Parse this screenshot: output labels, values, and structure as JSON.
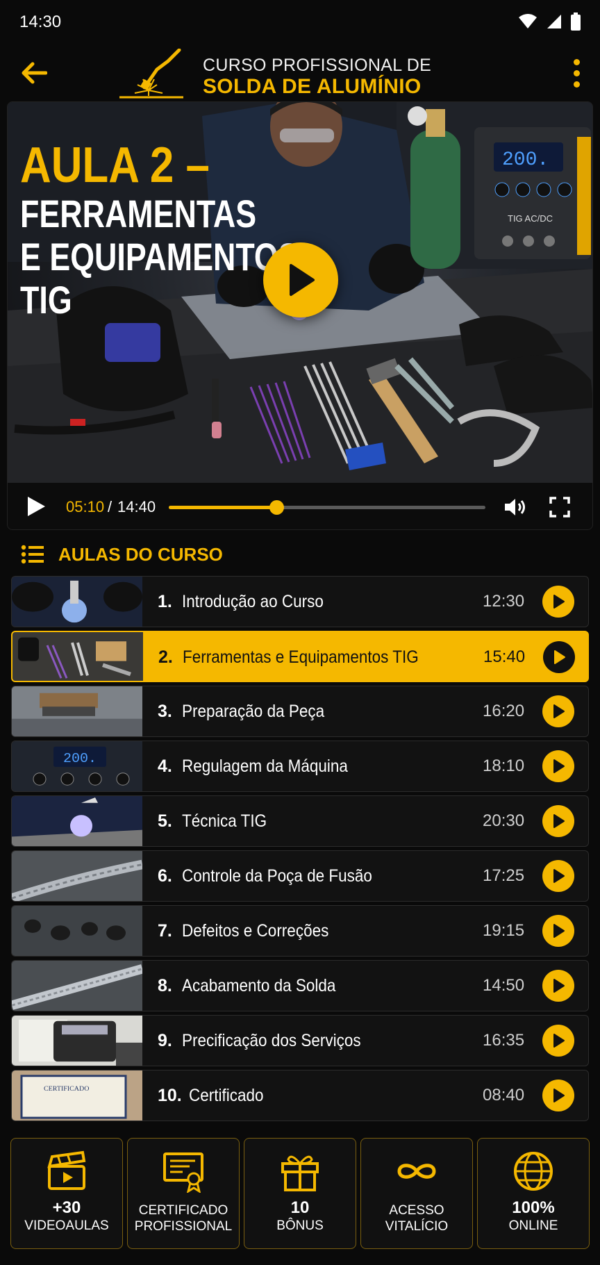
{
  "status_bar": {
    "time": "14:30",
    "icons": [
      "wifi-icon",
      "signal-icon",
      "battery-icon"
    ]
  },
  "header": {
    "title_line1": "CURSO PROFISSIONAL DE",
    "title_line2": "SOLDA DE ALUMÍNIO",
    "back_icon": "arrow-left-icon",
    "menu_icon": "more-vertical-icon"
  },
  "video": {
    "title_line1": "AULA 2 –",
    "title_line2": "FERRAMENTAS",
    "title_line3": "E EQUIPAMENTOS",
    "title_line4": "TIG",
    "machine_display": "200.",
    "machine_label": "TIG AC/DC",
    "current_time": "05:10",
    "separator": "/",
    "total_time": "14:40",
    "progress": 0.339
  },
  "section": {
    "title": "AULAS DO CURSO"
  },
  "lessons": [
    {
      "num": "1.",
      "title": "Introdução ao Curso",
      "duration": "12:30",
      "active": false
    },
    {
      "num": "2.",
      "title": "Ferramentas e Equipamentos TIG",
      "duration": "15:40",
      "active": true
    },
    {
      "num": "3.",
      "title": "Preparação da Peça",
      "duration": "16:20",
      "active": false
    },
    {
      "num": "4.",
      "title": "Regulagem da Máquina",
      "duration": "18:10",
      "active": false
    },
    {
      "num": "5.",
      "title": "Técnica TIG",
      "duration": "20:30",
      "active": false
    },
    {
      "num": "6.",
      "title": "Controle da Poça de Fusão",
      "duration": "17:25",
      "active": false
    },
    {
      "num": "7.",
      "title": "Defeitos e Correções",
      "duration": "19:15",
      "active": false
    },
    {
      "num": "8.",
      "title": "Acabamento da Solda",
      "duration": "14:50",
      "active": false
    },
    {
      "num": "9.",
      "title": "Precificação dos Serviços",
      "duration": "16:35",
      "active": false
    },
    {
      "num": "10.",
      "title": "Certificado",
      "duration": "08:40",
      "active": false
    }
  ],
  "lesson_thumb_texts": {
    "machine": "200.",
    "certificate": "CERTIFICADO"
  },
  "features": [
    {
      "icon": "clapperboard-icon",
      "big": "+30",
      "small1": "VIDEOAULAS",
      "small2": ""
    },
    {
      "icon": "certificate-icon",
      "big": "",
      "small1": "CERTIFICADO",
      "small2": "PROFISSIONAL"
    },
    {
      "icon": "gift-icon",
      "big": "10",
      "small1": "BÔNUS",
      "small2": ""
    },
    {
      "icon": "infinity-icon",
      "big": "",
      "small1": "ACESSO",
      "small2": "VITALÍCIO"
    },
    {
      "icon": "globe-icon",
      "big": "100%",
      "small1": "ONLINE",
      "small2": ""
    }
  ],
  "colors": {
    "accent": "#f5b800",
    "background": "#0a0a0a",
    "row": "#121212"
  }
}
